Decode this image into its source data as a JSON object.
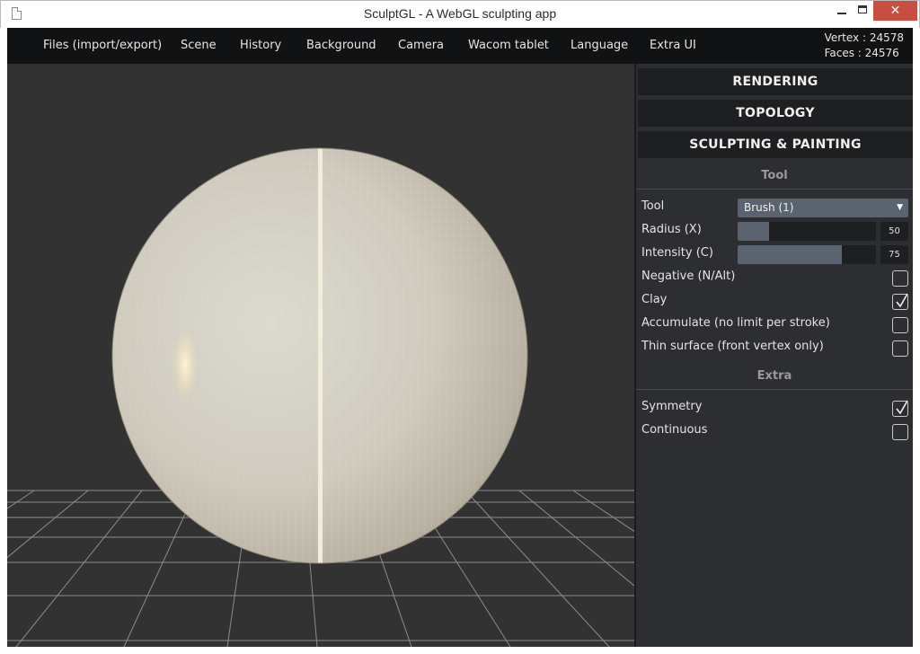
{
  "window": {
    "title": "SculptGL - A WebGL sculpting app",
    "minimize": "–",
    "maximize": "□",
    "close": "✕"
  },
  "menu": {
    "items": [
      "Files (import/export)",
      "Scene",
      "History",
      "Background",
      "Camera",
      "Wacom tablet",
      "Language",
      "Extra UI"
    ]
  },
  "stats": {
    "vertex": "Vertex : 24578",
    "faces": "Faces : 24576"
  },
  "panel": {
    "sections": [
      "RENDERING",
      "TOPOLOGY",
      "SCULPTING & PAINTING"
    ],
    "tool_group": {
      "title": "Tool",
      "tool_label": "Tool",
      "tool_value": "Brush (1)",
      "radius_label": "Radius (X)",
      "radius_value": "50",
      "radius_fraction": 0.23,
      "intensity_label": "Intensity (C)",
      "intensity_value": "75",
      "intensity_fraction": 0.75,
      "options": [
        {
          "label": "Negative (N/Alt)",
          "checked": false
        },
        {
          "label": "Clay",
          "checked": true
        },
        {
          "label": "Accumulate (no limit per stroke)",
          "checked": false
        },
        {
          "label": "Thin surface (front vertex only)",
          "checked": false
        }
      ]
    },
    "extra_group": {
      "title": "Extra",
      "options": [
        {
          "label": "Symmetry",
          "checked": true
        },
        {
          "label": "Continuous",
          "checked": false
        }
      ]
    }
  },
  "colors": {
    "menubar_bg": "#111214",
    "panel_bg": "#2c2e31",
    "accent": "#5a6470",
    "viewport_bg": "#323232",
    "close_button": "#c74e41"
  },
  "icons": {
    "document": "document-icon",
    "dropdown": "chevron-down-icon",
    "check": "checkmark-icon"
  }
}
